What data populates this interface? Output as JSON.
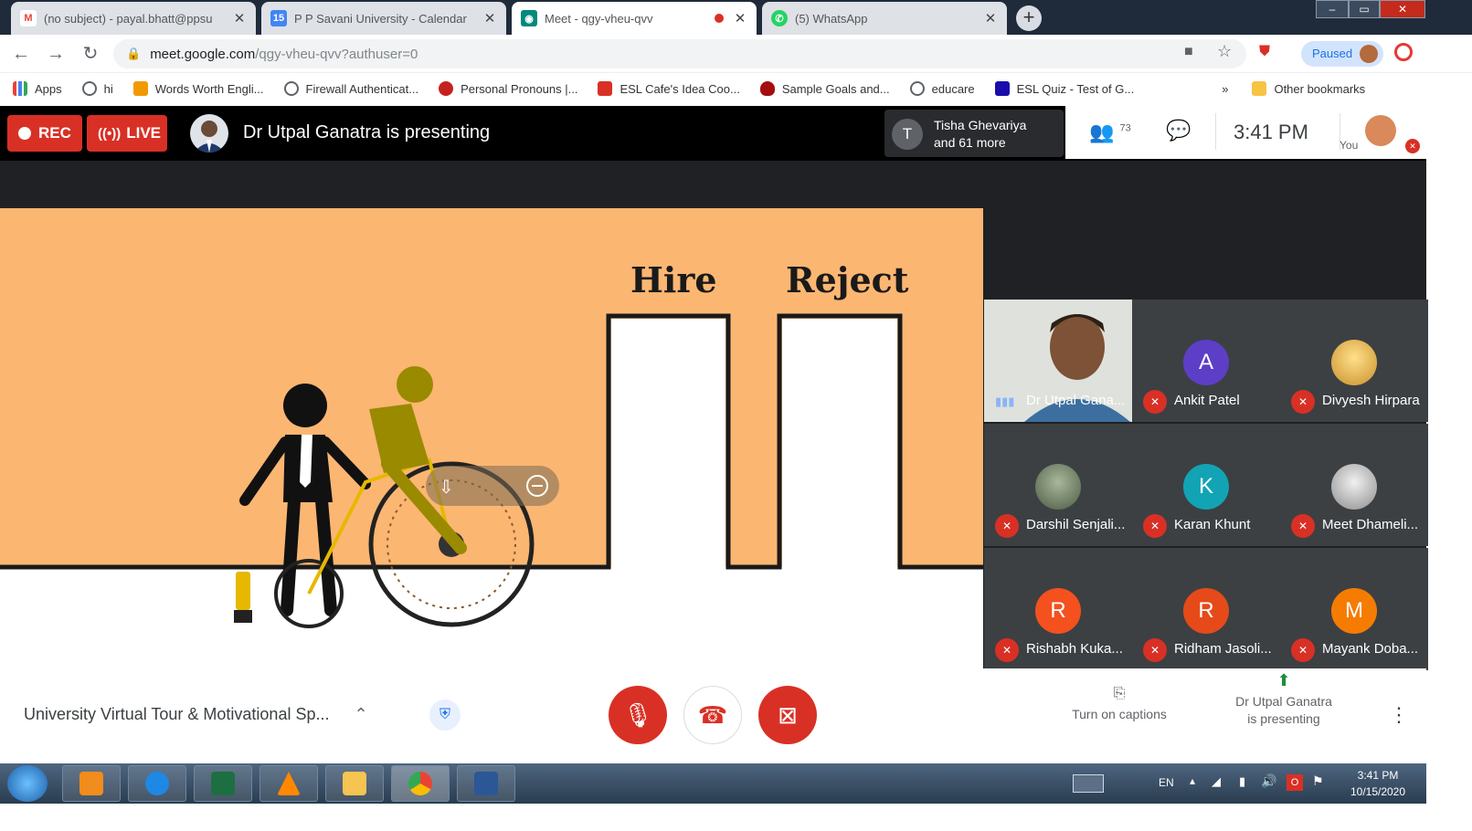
{
  "browser": {
    "tabs": [
      {
        "title": "(no subject) - payal.bhatt@ppsu",
        "favicon": "gmail-icon",
        "color": "#ea4335",
        "active": false
      },
      {
        "title": "P P Savani University - Calendar",
        "favicon": "calendar-icon",
        "color": "#4285f4",
        "active": false
      },
      {
        "title": "Meet - qgy-vheu-qvv",
        "favicon": "meet-icon",
        "color": "#00897b",
        "active": true
      },
      {
        "title": "(5) WhatsApp",
        "favicon": "whatsapp-icon",
        "color": "#25d366",
        "active": false
      }
    ],
    "url_host": "meet.google.com",
    "url_path": "/qgy-vheu-qvv?authuser=0",
    "profile_status": "Paused",
    "bookmarks": [
      {
        "label": "Apps",
        "icon": "apps-grid-icon",
        "color": "#4285f4"
      },
      {
        "label": "hi",
        "icon": "globe-icon",
        "color": "#5f6368"
      },
      {
        "label": "Words Worth Engli...",
        "icon": "ww-icon",
        "color": "#f29900"
      },
      {
        "label": "Firewall Authenticat...",
        "icon": "globe-icon",
        "color": "#5f6368"
      },
      {
        "label": "Personal Pronouns |...",
        "icon": "red-circle-icon",
        "color": "#c5221f"
      },
      {
        "label": "ESL Cafe's Idea Coo...",
        "icon": "esl-icon",
        "color": "#d93025"
      },
      {
        "label": "Sample Goals and...",
        "icon": "shield-icon",
        "color": "#a50e0e"
      },
      {
        "label": "educare",
        "icon": "globe-icon",
        "color": "#5f6368"
      },
      {
        "label": "ESL Quiz - Test of G...",
        "icon": "quiz-icon",
        "color": "#1a0dab"
      }
    ],
    "bookmarks_overflow": "»",
    "other_bookmarks": "Other bookmarks"
  },
  "meet": {
    "rec_label": "REC",
    "live_label": "LIVE",
    "presenting_text": "Dr Utpal Ganatra is presenting",
    "joiner_initial": "T",
    "joiner_line1": "Tisha Ghevariya",
    "joiner_line2": "and 61 more",
    "participant_count": "73",
    "clock": "3:41 PM",
    "you_label": "You",
    "slide": {
      "word_hire": "Hire",
      "word_reject": "Reject"
    },
    "participants": [
      {
        "name": "Dr Utpal Gana...",
        "type": "video"
      },
      {
        "name": "Ankit Patel",
        "initial": "A",
        "color": "#5c3fc6"
      },
      {
        "name": "Divyesh Hirpara",
        "initial": "",
        "color": "#e8b44a",
        "type": "photo"
      },
      {
        "name": "Darshil Senjali...",
        "initial": "",
        "color": "#7a8b6a",
        "type": "photo"
      },
      {
        "name": "Karan Khunt",
        "initial": "K",
        "color": "#12a4b4"
      },
      {
        "name": "Meet Dhameli...",
        "initial": "",
        "color": "#c9c9c9",
        "type": "photo"
      },
      {
        "name": "Rishabh Kuka...",
        "initial": "R",
        "color": "#f4511e"
      },
      {
        "name": "Ridham Jasoli...",
        "initial": "R",
        "color": "#e64a19"
      },
      {
        "name": "Mayank Doba...",
        "initial": "M",
        "color": "#f57c00"
      }
    ],
    "meeting_title": "University Virtual Tour & Motivational Sp...",
    "captions_label": "Turn on captions",
    "presenting_line1": "Dr Utpal Ganatra",
    "presenting_line2": "is presenting"
  },
  "taskbar": {
    "apps": [
      {
        "name": "start-button",
        "color": "#2d7bd6"
      },
      {
        "name": "media-player-icon",
        "color": "#f28c1c"
      },
      {
        "name": "internet-explorer-icon",
        "color": "#1e88e5"
      },
      {
        "name": "excel-icon",
        "color": "#1d6f42"
      },
      {
        "name": "vlc-icon",
        "color": "#ff8800"
      },
      {
        "name": "file-explorer-icon",
        "color": "#f5c451"
      },
      {
        "name": "chrome-icon",
        "color": "#34a853"
      },
      {
        "name": "word-icon",
        "color": "#2b5797"
      }
    ],
    "language": "EN",
    "time": "3:41 PM",
    "date": "10/15/2020"
  }
}
